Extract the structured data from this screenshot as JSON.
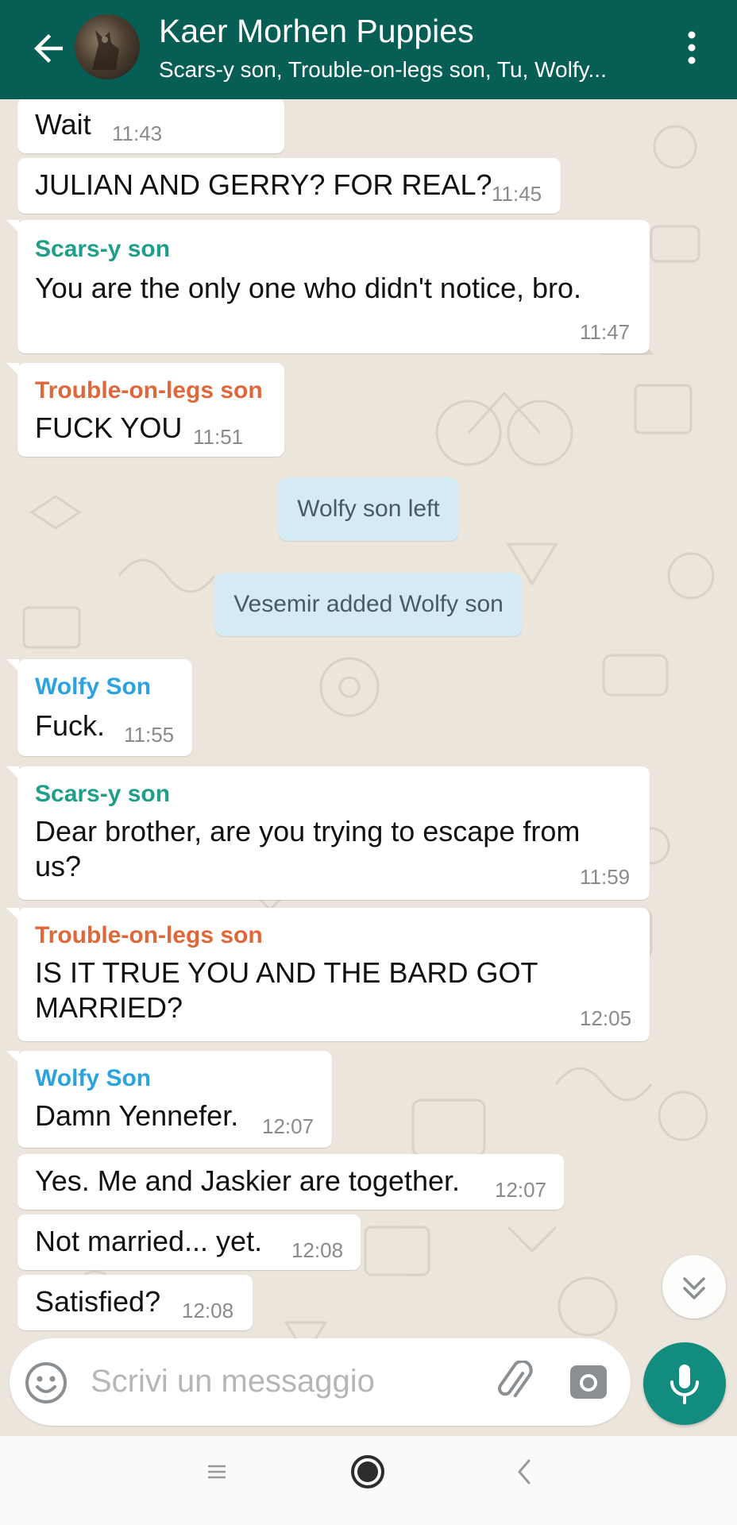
{
  "header": {
    "title": "Kaer Morhen Puppies",
    "subtitle": "Scars-y son, Trouble-on-legs son, Tu, Wolfy...",
    "bg_color": "#075e54"
  },
  "messages": [
    {
      "text": "Wait",
      "time": "11:43"
    },
    {
      "text": "JULIAN AND GERRY? FOR REAL?",
      "time": "11:45"
    },
    {
      "sender": "Scars-y son",
      "sender_color": "#1f9f8a",
      "text": "You are the only one who didn't notice, bro.",
      "time": "11:47"
    },
    {
      "sender": "Trouble-on-legs son",
      "sender_color": "#e0673a",
      "text": "FUCK YOU",
      "time": "11:51"
    },
    {
      "system": "Wolfy son left"
    },
    {
      "system": "Vesemir added Wolfy son"
    },
    {
      "sender": "Wolfy Son",
      "sender_color": "#2aa3e0",
      "text": "Fuck.",
      "time": "11:55"
    },
    {
      "sender": "Scars-y son",
      "sender_color": "#1f9f8a",
      "text_line1": "Dear brother, are you trying to escape from",
      "text_line2": "us?",
      "time": "11:59"
    },
    {
      "sender": "Trouble-on-legs son",
      "sender_color": "#e0673a",
      "text_line1": "IS IT TRUE YOU AND THE BARD GOT",
      "text_line2": "MARRIED?",
      "time": "12:05"
    },
    {
      "sender": "Wolfy Son",
      "sender_color": "#2aa3e0",
      "text": "Damn Yennefer.",
      "time": "12:07"
    },
    {
      "text": "Yes. Me and Jaskier are together.",
      "time": "12:07"
    },
    {
      "text": "Not married... yet.",
      "time": "12:08"
    },
    {
      "text": "Satisfied?",
      "time": "12:08"
    }
  ],
  "composer": {
    "placeholder": "Scrivi un messaggio",
    "accent_color": "#128c7e"
  },
  "icons": {
    "back": "arrow-left-icon",
    "menu": "more-vert-icon",
    "emoji": "emoji-icon",
    "attach": "paperclip-icon",
    "camera": "camera-icon",
    "mic": "microphone-icon",
    "scroll_down": "double-chevron-down-icon"
  }
}
